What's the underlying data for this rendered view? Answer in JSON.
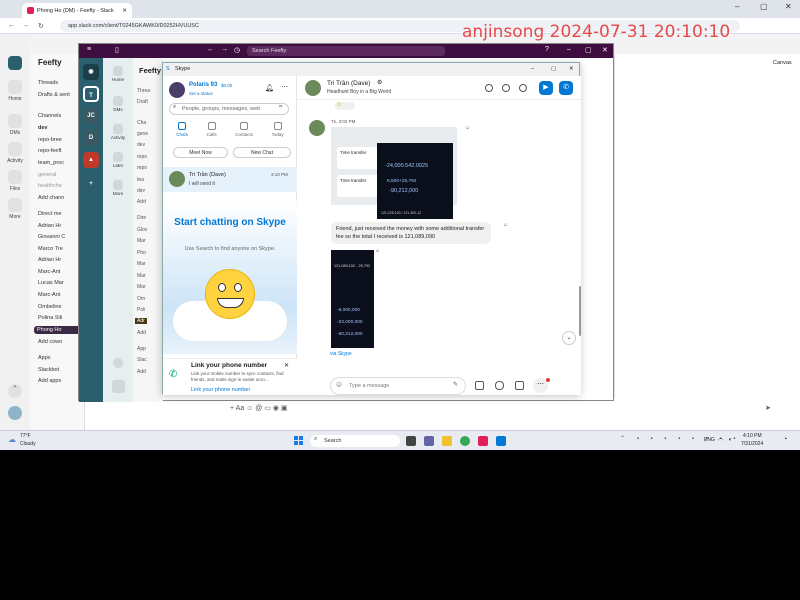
{
  "browser": {
    "tab_title": "Phong Ho (DM) - Feefty - Slack",
    "url": "app.slack.com/client/T0245GKAWK0/D0252HVUUSC"
  },
  "watermark": "anjinsong 2024-07-31 20:10:10",
  "slack": {
    "workspace": "Feefty",
    "rail": [
      "Home",
      "DMs",
      "Activity",
      "Files",
      "More"
    ],
    "top_items": [
      "Threads",
      "Drafts & sent"
    ],
    "channels_header": "Channels",
    "channels": [
      "dev",
      "repo-bree",
      "repo-feeft",
      "team_proc",
      "general",
      "healthche"
    ],
    "add_channel": "Add chann",
    "dm_header": "Direct me",
    "dms": [
      "Adrian Hr",
      "Giovanni C",
      "Marco Tre",
      "Adrian Hr",
      "Marc-Ant",
      "Lucas Mar",
      "Marc-Ant",
      "Ombeline",
      "Polina Sili",
      "Phong Ho"
    ],
    "add_coworkers": "Add cowo",
    "apps_header": "Apps",
    "apps": [
      "Slackbot"
    ],
    "add_apps": "Add apps",
    "canvas": "Canvas"
  },
  "feefty": {
    "search_placeholder": "Search Feefty",
    "workspace": "Feefty",
    "rail_labels": [
      "Home",
      "DMs",
      "Activity",
      "Later",
      "More"
    ],
    "rail_badges": [
      "JC",
      "D"
    ],
    "side_items": [
      "Threa",
      "Draft",
      "Cha",
      "gene",
      "dev",
      "repo",
      "repo",
      "tea",
      "dev",
      "Add",
      "Dire",
      "Glov",
      "Mar",
      "Pho",
      "Mar",
      "Mar",
      "Mar",
      "Om",
      "Poli",
      "Adr",
      "Add",
      "App",
      "Slac",
      "Add"
    ]
  },
  "skype": {
    "title": "Skype",
    "profile": {
      "name": "Polaris 93",
      "balance": "$0.00",
      "status": "Set a status"
    },
    "search_placeholder": "People, groups, messages, web",
    "tabs": [
      "Chats",
      "Calls",
      "Contacts",
      "Today"
    ],
    "meet_now": "Meet Now",
    "new_chat": "New Chat",
    "recent_chat": {
      "name": "Tri Trần (Dave)",
      "preview": "I will send it",
      "time": "3:19 PM"
    },
    "start_title": "Start chatting on Skype",
    "start_sub": "Use  Search to find anyone on Skype.",
    "link_title": "Link your phone number",
    "link_body": "Link your mobile number to sync contacts, find friends, and make sign-in easier acro...",
    "link_cta": "Link your phone number",
    "chat": {
      "name": "Tri Trần (Dave)",
      "mood": "Headhunt Boy in a Big World",
      "msg_time": "Tri, 3:02 PM",
      "shot1_lines": [
        "Time transfer",
        "Time transfer",
        "-24,000.542.0025",
        "8,500+25,792",
        "-90,212,000",
        "121,228,100 / 121,300-12"
      ],
      "shot2_lines": [
        "121,089,100 - 25,792",
        "-8,000,000",
        "-23,000,000",
        "-60,212,000"
      ],
      "message": "Friend, just received the money with some additional transfer fee so the total I received is 121,089,090",
      "via": "via Skype",
      "composer_placeholder": "Type a message"
    }
  },
  "taskbar": {
    "weather_temp": "77°F",
    "weather_desc": "Cloudy",
    "search": "Search",
    "lang": "ENG",
    "time": "4:10 PM",
    "date": "7/31/2024"
  }
}
